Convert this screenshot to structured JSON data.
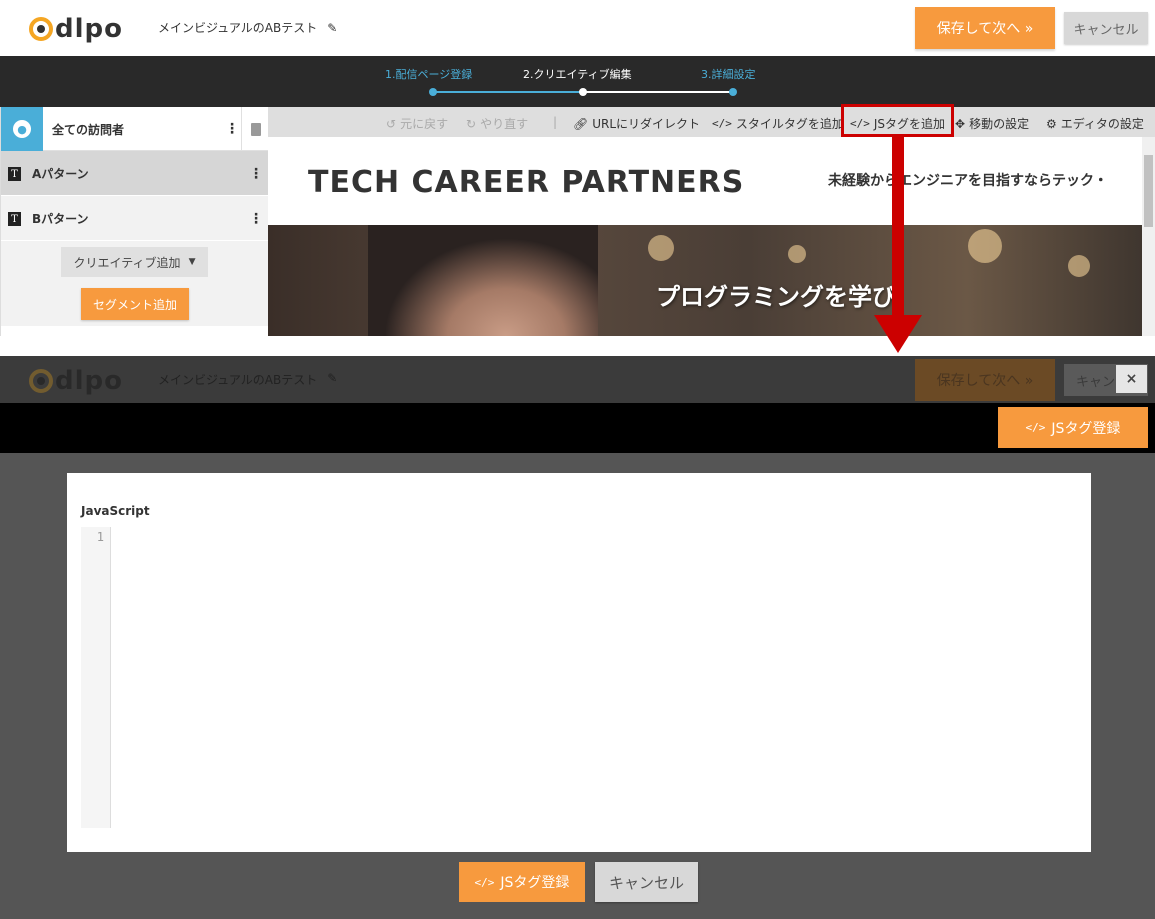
{
  "top": {
    "logo_text": "dlpo",
    "test_name": "メインビジュアルのABテスト",
    "save_next": "保存して次へ »",
    "cancel": "キャンセル",
    "steps": [
      {
        "label": "1.配信ページ登録",
        "state": "done"
      },
      {
        "label": "2.クリエイティブ編集",
        "state": "active"
      },
      {
        "label": "3.詳細設定",
        "state": "pending"
      }
    ],
    "sidebar": {
      "all_visitors": "全ての訪問者",
      "patterns": [
        {
          "badge": "T",
          "label": "Aパターン"
        },
        {
          "badge": "T",
          "label": "Bパターン"
        }
      ],
      "add_creative": "クリエイティブ追加",
      "add_segment": "セグメント追加"
    },
    "toolbar": {
      "undo": "元に戻す",
      "redo": "やり直す",
      "separator": "|",
      "redirect": "URLにリダイレクト",
      "style_tag": "スタイルタグを追加",
      "js_tag": "JSタグを追加",
      "move": "移動の設定",
      "editor_settings": "エディタの設定"
    },
    "preview": {
      "brand": "TECH CAREER PARTNERS",
      "tagline": "未経験からエンジニアを目指すならテック・",
      "hero_text": "プログラミングを学び"
    }
  },
  "modal": {
    "dim_logo_text": "dlpo",
    "dim_test_name": "メインビジュアルのABテスト",
    "dim_save": "保存して次へ »",
    "dim_cancel": "キャン",
    "close": "×",
    "register_js": "JSタグ登録",
    "code_icon": "</>",
    "editor_label": "JavaScript",
    "line_number": "1",
    "code_value": "",
    "cancel": "キャンセル"
  },
  "colors": {
    "accent": "#f79a3e",
    "step_blue": "#4aaed8",
    "highlight_red": "#cc0000"
  }
}
